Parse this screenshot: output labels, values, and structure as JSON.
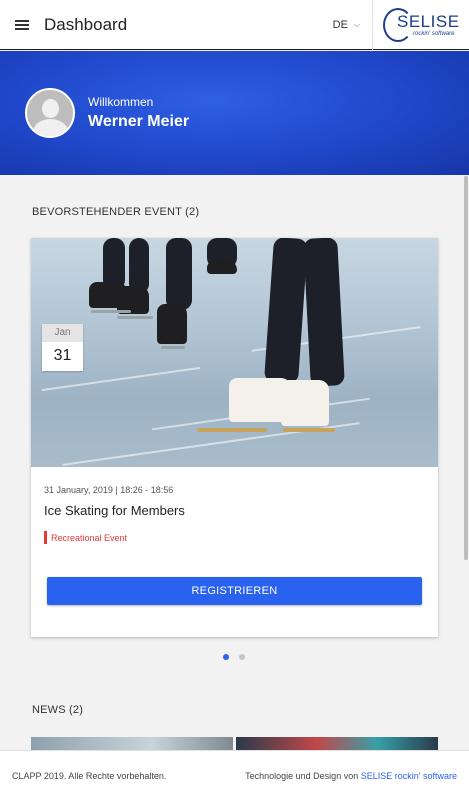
{
  "appbar": {
    "title": "Dashboard",
    "language": "DE",
    "logo_name": "SELISE",
    "logo_tagline": "rockin' software"
  },
  "hero": {
    "welcome": "Willkommen",
    "user_name": "Werner Meier"
  },
  "events": {
    "section_title": "BEVORSTEHENDER EVENT (2)",
    "items": [
      {
        "month": "Jan",
        "day": "31",
        "meta": "31 January, 2019 | 18:26 - 18:56",
        "title": "Ice Skating for Members",
        "tag": "Recreational Event",
        "button": "REGISTRIEREN"
      }
    ],
    "pager_count": 2,
    "pager_active": 1
  },
  "news": {
    "section_title": "NEWS (2)"
  },
  "footer": {
    "copyright": "CLAPP 2019. Alle Rechte vorbehalten.",
    "credit_prefix": "Technologie und Design von",
    "credit_link": "SELISE rockin' software"
  },
  "colors": {
    "primary": "#2a62f0",
    "hero_blue": "#1f47c9",
    "tag_red": "#e53935"
  },
  "icons": {
    "menu": "hamburger-menu-icon",
    "language_dropdown": "chevron-down-icon",
    "avatar": "user-avatar-icon"
  }
}
